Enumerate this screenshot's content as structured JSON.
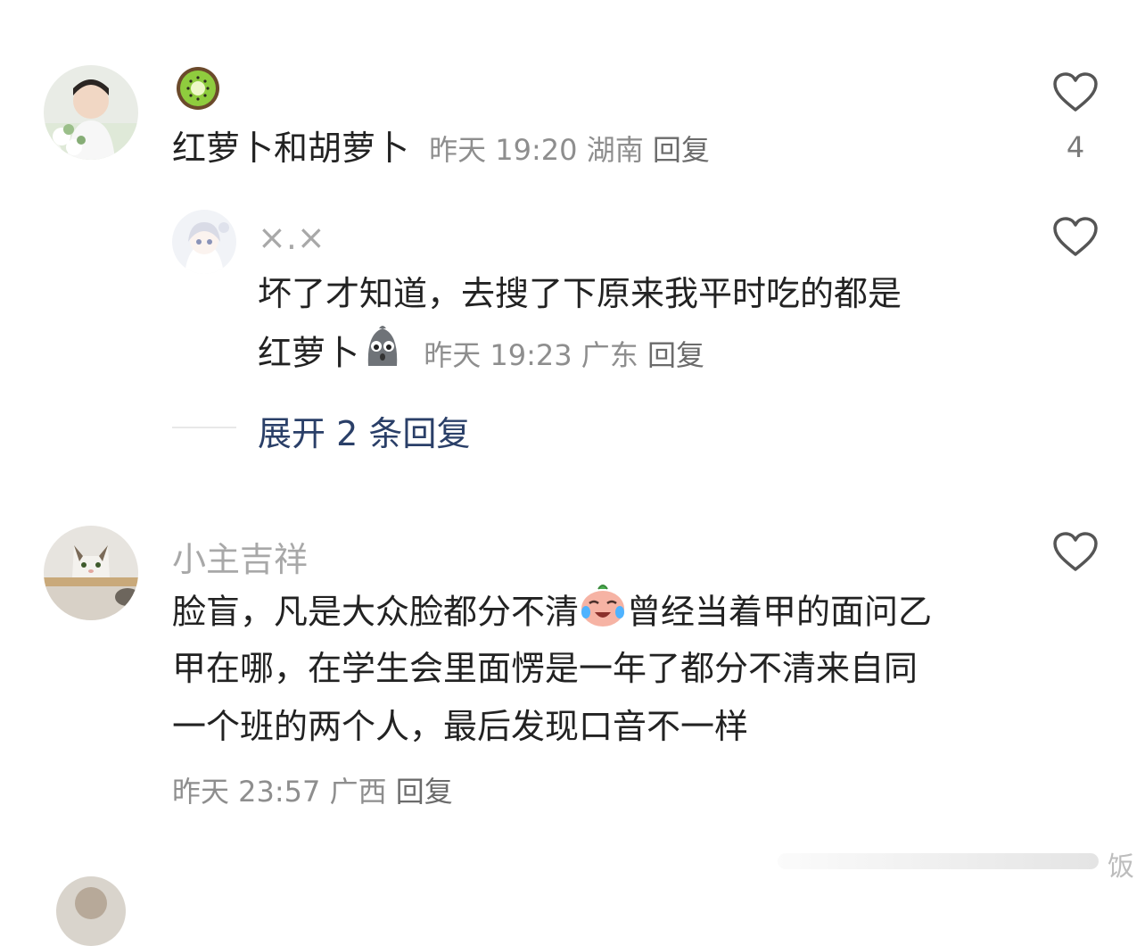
{
  "comments": [
    {
      "text": "红萝卜和胡萝卜",
      "meta": {
        "time": "昨天 19:20",
        "location": "湖南",
        "reply": "回复"
      },
      "likes": "4",
      "name_emoji": "kiwi-emoji"
    },
    {
      "name": "×.×",
      "text_line1": "坏了才知道，去搜了下原来我平时吃的都是",
      "text_line2": "红萝卜",
      "meta": {
        "time": "昨天 19:23",
        "location": "广东",
        "reply": "回复"
      },
      "inline_emoji": "ghost-face-emoji"
    },
    {
      "name": "小主吉祥",
      "text_line1a": "脸盲，凡是大众脸都分不清",
      "text_line1b": "曾经当着甲的面问乙",
      "text_line2": "甲在哪，在学生会里面愣是一年了都分不清来自同",
      "text_line3": "一个班的两个人，最后发现口音不一样",
      "meta": {
        "time": "昨天 23:57",
        "location": "广西",
        "reply": "回复"
      },
      "inline_emoji": "crying-laughing-emoji"
    }
  ],
  "expand_replies": "展开 2 条回复",
  "watermark": "饭"
}
